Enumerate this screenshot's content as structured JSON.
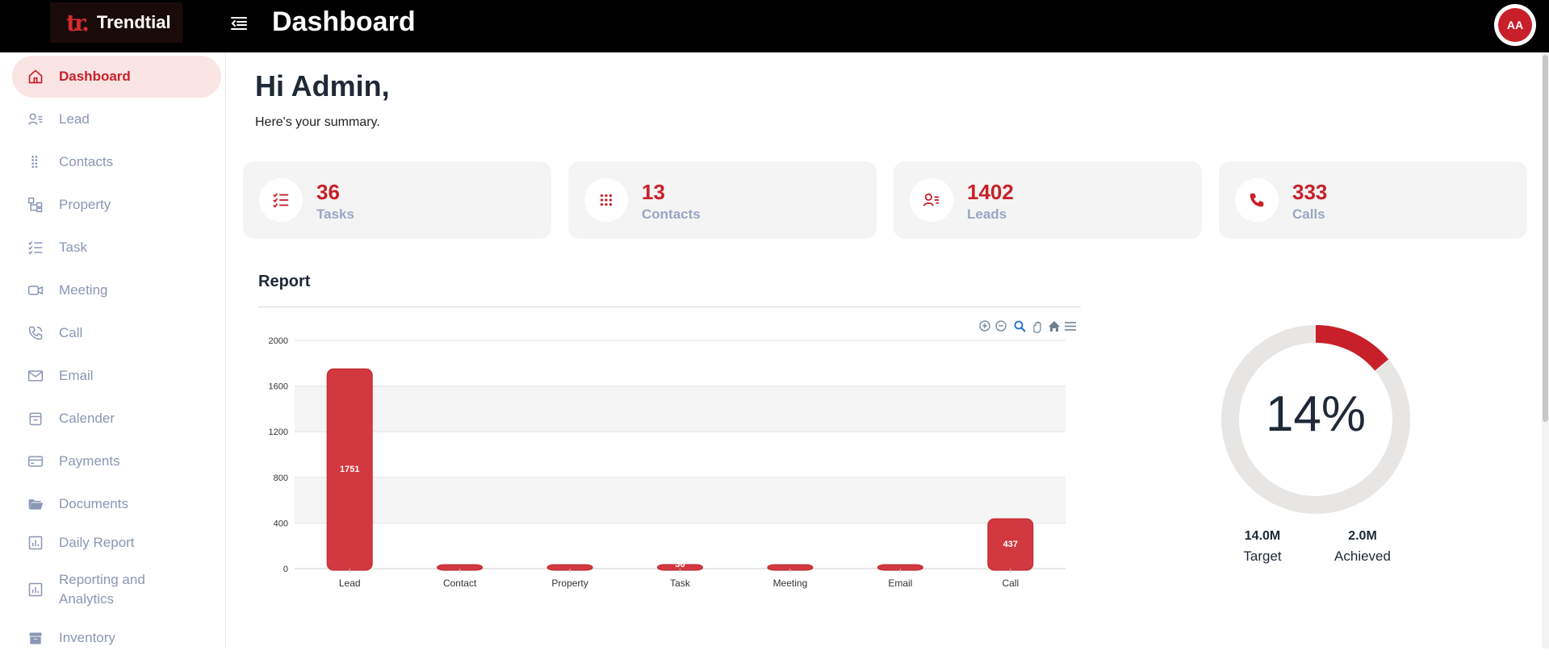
{
  "brand": {
    "name": "Trendtial",
    "mark": "tr."
  },
  "header": {
    "title": "Dashboard",
    "avatar_initials": "AA"
  },
  "sidebar": {
    "items": [
      {
        "label": "Dashboard",
        "icon": "home-icon"
      },
      {
        "label": "Lead",
        "icon": "lead-icon"
      },
      {
        "label": "Contacts",
        "icon": "contacts-icon"
      },
      {
        "label": "Property",
        "icon": "property-icon"
      },
      {
        "label": "Task",
        "icon": "task-icon"
      },
      {
        "label": "Meeting",
        "icon": "meeting-icon"
      },
      {
        "label": "Call",
        "icon": "call-icon"
      },
      {
        "label": "Email",
        "icon": "email-icon"
      },
      {
        "label": "Calender",
        "icon": "calendar-icon"
      },
      {
        "label": "Payments",
        "icon": "payments-icon"
      },
      {
        "label": "Documents",
        "icon": "documents-icon"
      },
      {
        "label": "Daily Report",
        "icon": "daily-report-icon"
      },
      {
        "label": "Reporting and Analytics",
        "icon": "analytics-icon"
      },
      {
        "label": "Inventory",
        "icon": "inventory-icon"
      }
    ]
  },
  "greeting": {
    "title": "Hi Admin,",
    "subtitle": "Here's your summary."
  },
  "summary_cards": [
    {
      "value": "36",
      "label": "Tasks",
      "icon": "tasks-icon"
    },
    {
      "value": "13",
      "label": "Contacts",
      "icon": "contacts-icon"
    },
    {
      "value": "1402",
      "label": "Leads",
      "icon": "leads-icon"
    },
    {
      "value": "333",
      "label": "Calls",
      "icon": "calls-icon"
    }
  ],
  "report": {
    "title": "Report"
  },
  "chart_toolbar": [
    "zoom-in-icon",
    "zoom-out-icon",
    "zoom-selection-icon",
    "pan-hand-icon",
    "reset-home-icon",
    "menu-icon"
  ],
  "chart_data": {
    "type": "bar",
    "categories": [
      "Lead",
      "Contact",
      "Property",
      "Task",
      "Meeting",
      "Email",
      "Call"
    ],
    "values": [
      1751,
      13,
      5,
      36,
      2,
      3,
      437
    ],
    "data_labels": [
      "1751",
      "",
      "",
      "36",
      "",
      "",
      "437"
    ],
    "ylim": [
      0,
      2000
    ],
    "yticks": [
      0,
      400,
      800,
      1200,
      1600,
      2000
    ],
    "grid": true,
    "bar_color": "#d1383f"
  },
  "goal": {
    "percent_label": "14%",
    "percent": 14,
    "target_value": "14.0M",
    "target_label": "Target",
    "achieved_value": "2.0M",
    "achieved_label": "Achieved",
    "accent_color": "#c8202a",
    "track_color": "#e8e6e4"
  }
}
